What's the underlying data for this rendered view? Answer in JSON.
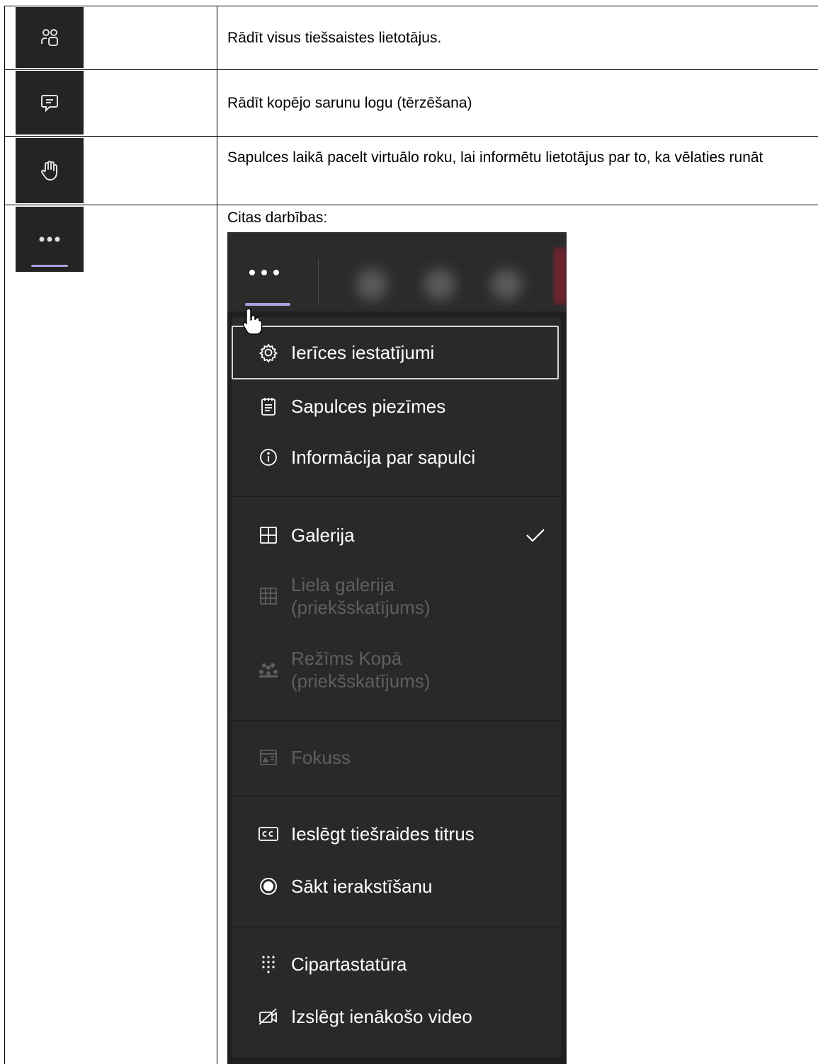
{
  "rows": [
    {
      "icon": "people-icon",
      "text": "Rādīt visus tiešsaistes lietotājus."
    },
    {
      "icon": "chat-icon",
      "text": "Rādīt kopējo sarunu logu (tērzēšana)"
    },
    {
      "icon": "raise-hand-icon",
      "text": "Sapulces laikā pacelt virtuālo roku, lai informētu lietotājus par to, ka vēlaties runāt"
    },
    {
      "icon": "more-options-icon",
      "text": "Citas darbības:"
    }
  ],
  "menu": {
    "items": [
      {
        "icon": "settings-icon",
        "label": "Ierīces iestatījumi",
        "enabled": true,
        "focused": true
      },
      {
        "icon": "notes-icon",
        "label": "Sapulces piezīmes",
        "enabled": true
      },
      {
        "icon": "info-icon",
        "label": "Informācija par sapulci",
        "enabled": true
      },
      {
        "icon": "gallery-icon",
        "label": "Galerija",
        "enabled": true,
        "checked": true
      },
      {
        "icon": "large-gallery-icon",
        "label": "Liela galerija (priekšskatījums)",
        "enabled": false
      },
      {
        "icon": "together-mode-icon",
        "label": "Režīms Kopā (priekšskatījums)",
        "enabled": false
      },
      {
        "icon": "focus-icon",
        "label": "Fokuss",
        "enabled": false
      },
      {
        "icon": "closed-captions-icon",
        "label": "Ieslēgt tiešraides titrus",
        "enabled": true
      },
      {
        "icon": "record-icon",
        "label": "Sākt ierakstīšanu",
        "enabled": true
      },
      {
        "icon": "dialpad-icon",
        "label": "Cipartastatūra",
        "enabled": true
      },
      {
        "icon": "video-off-icon",
        "label": "Izslēgt ienākošo video",
        "enabled": true
      }
    ]
  },
  "colors": {
    "tile_bg": "#252423",
    "accent": "#a6a3e3",
    "menu_bg": "#292929",
    "disabled_text": "#5f5f5f"
  }
}
